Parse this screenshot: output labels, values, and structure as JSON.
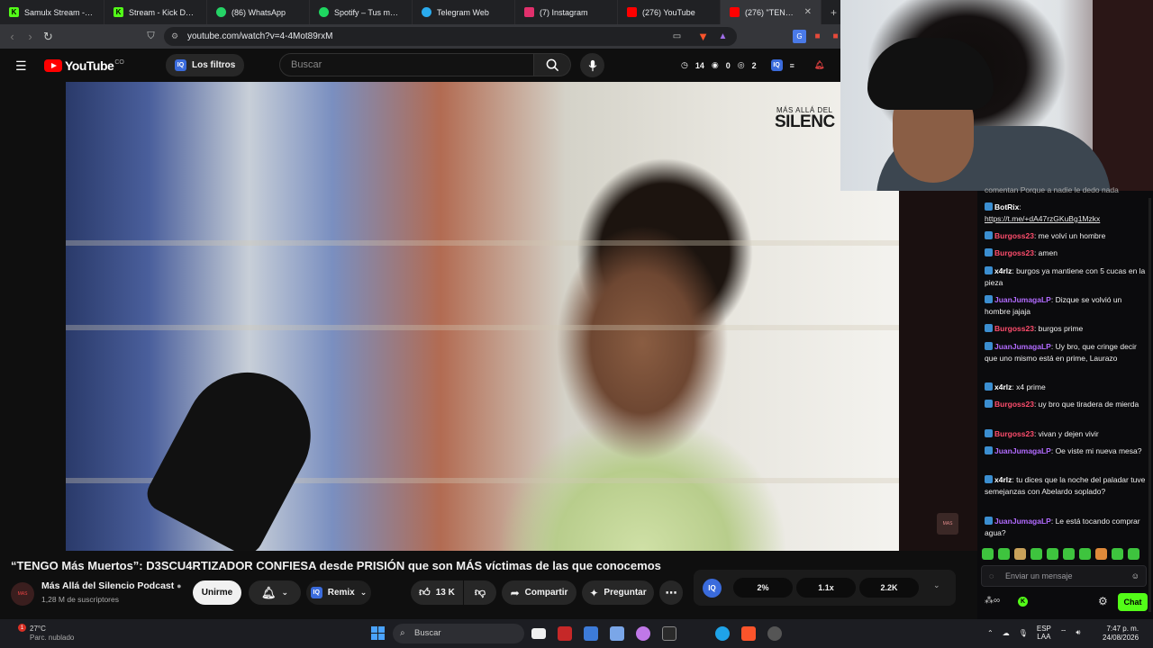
{
  "browser": {
    "tabs": [
      {
        "label": "Samulx Stream - Watc",
        "icon": "kick-icon",
        "color": "#53fc18"
      },
      {
        "label": "Stream - Kick Dashboa",
        "icon": "kick-icon",
        "color": "#53fc18"
      },
      {
        "label": "(86) WhatsApp",
        "icon": "whatsapp-icon",
        "color": "#25d366"
      },
      {
        "label": "Spotify – Tus me gusta",
        "icon": "spotify-icon",
        "color": "#1ed760"
      },
      {
        "label": "Telegram Web",
        "icon": "telegram-icon",
        "color": "#2aabee"
      },
      {
        "label": "(7) Instagram",
        "icon": "instagram-icon",
        "color": "#e1306c"
      },
      {
        "label": "(276) YouTube",
        "icon": "youtube-icon",
        "color": "#ff0000"
      },
      {
        "label": "(276) \"TENGO I",
        "icon": "youtube-icon",
        "color": "#ff0000",
        "active": true
      }
    ],
    "url": "youtube.com/watch?v=4-4Mot89rxM"
  },
  "youtube": {
    "logo_text": "YouTube",
    "country_code": "CO",
    "filters_label": "Los filtros",
    "search_placeholder": "Buscar",
    "stats": {
      "time": "14",
      "views": "0",
      "users": "2"
    }
  },
  "video": {
    "overlay_logo_top": "MÁS ALLÁ DEL",
    "overlay_logo_main": "SILENC",
    "title": "“TENGO Más Muertos”: D3SCU4RTIZADOR CONFIESA desde PRISIÓN que son MÁS víctimas de las que conocemos",
    "channel_name": "Más Allá del Silencio Podcast",
    "subscribers": "1,28 M de suscriptores",
    "join_label": "Unirme",
    "remix_label": "Remix",
    "likes": "13 K",
    "share_label": "Compartir",
    "ask_label": "Preguntar",
    "iq_values": [
      "2%",
      "1.1x",
      "2.2K"
    ]
  },
  "chat": {
    "top_cut": "comentan Porque a nadie le dedo nada",
    "messages": [
      {
        "user": "BotRix",
        "color": "#ffffff",
        "text": "https://t.me/+dA47rzGKuBg1Mzkx",
        "link": true
      },
      {
        "user": "Burgoss23",
        "color": "#ff4d6d",
        "text": "me volví un hombre"
      },
      {
        "user": "Burgoss23",
        "color": "#ff4d6d",
        "text": "amen"
      },
      {
        "user": "x4rlz",
        "color": "#ffffff",
        "text": "burgos ya mantiene con 5 cucas en la pieza"
      },
      {
        "user": "JuanJumagaLP",
        "color": "#b26bff",
        "text": "Dizque se volvió un hombre jajaja"
      },
      {
        "user": "Burgoss23",
        "color": "#ff4d6d",
        "text": "burgos prime"
      },
      {
        "user": "JuanJumagaLP",
        "color": "#b26bff",
        "text": "Uy bro, que cringe decir que uno mismo está en prime, Laurazo"
      },
      {
        "user": "x4rlz",
        "color": "#ffffff",
        "text": "x4 prime"
      },
      {
        "user": "Burgoss23",
        "color": "#ff4d6d",
        "text": "uy bro que tiradera de mierda"
      },
      {
        "user": "Burgoss23",
        "color": "#ff4d6d",
        "text": "vivan y dejen vivir"
      },
      {
        "user": "JuanJumagaLP",
        "color": "#b26bff",
        "text": "Oe viste mi nueva mesa?"
      },
      {
        "user": "x4rlz",
        "color": "#ffffff",
        "text": "tu dices que la noche del paladar tuve semejanzas con Abelardo soplado?"
      },
      {
        "user": "JuanJumagaLP",
        "color": "#b26bff",
        "text": "Le está tocando comprar agua?"
      }
    ],
    "input_placeholder": "Enviar un mensaje",
    "send_label": "Chat"
  },
  "taskbar": {
    "temperature": "27°C",
    "weather": "Parc. nublado",
    "notif_count": "1",
    "search_placeholder": "Buscar",
    "lang_top": "ESP",
    "lang_bottom": "LAA",
    "time": "7:47 p. m.",
    "date": "24/08/2026"
  }
}
